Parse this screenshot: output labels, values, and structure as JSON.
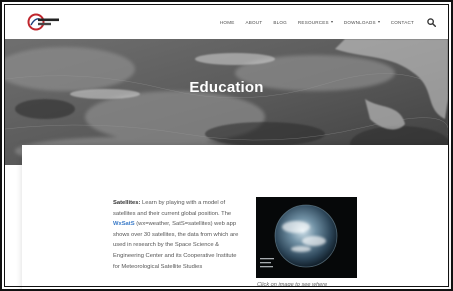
{
  "header": {
    "logo_alt": "Wisconsin WXSAT",
    "nav": [
      {
        "label": "HOME",
        "dropdown": false
      },
      {
        "label": "ABOUT",
        "dropdown": false
      },
      {
        "label": "BLOG",
        "dropdown": false
      },
      {
        "label": "RESOURCES",
        "dropdown": true
      },
      {
        "label": "DOWNLOADS",
        "dropdown": true
      },
      {
        "label": "CONTACT",
        "dropdown": false
      }
    ],
    "search_icon": "search-icon"
  },
  "hero": {
    "title": "Education"
  },
  "content": {
    "satellites_heading": "Satellites:",
    "intro": " Learn by playing with a model of satellites and their current global position. The ",
    "link_label": "WxSatS",
    "body": " (wx=weather, SatS=satellites) web app shows over 30 satellites, the data from which are used in research by the Space Science & Engineering Center and its Cooperative Institute for Meteorological Satellite Studies",
    "image_caption": "Click on image to see where"
  },
  "colors": {
    "accent_link": "#3b7bc8",
    "text": "#555555",
    "hero_text": "#ffffff"
  }
}
